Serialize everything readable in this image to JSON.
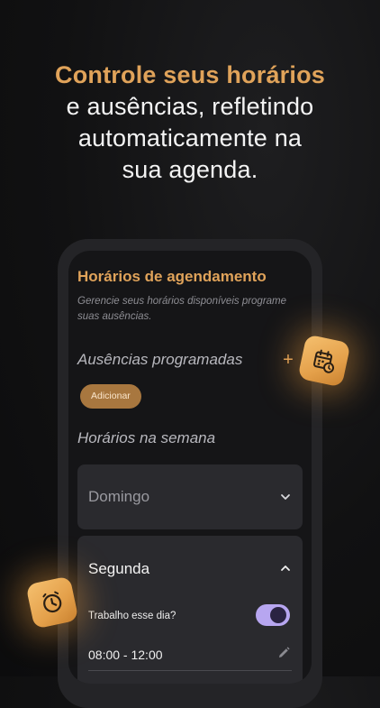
{
  "headline": {
    "line1": "Controle seus horários",
    "line2": "e ausências, refletindo",
    "line3": "automaticamente na",
    "line4": "sua agenda."
  },
  "screen": {
    "title": "Horários de agendamento",
    "subtitle": "Gerencie seus horários disponíveis programe suas ausências.",
    "absences_label": "Ausências programadas",
    "plus_symbol": "+",
    "add_button": "Adicionar",
    "week_label": "Horários na semana",
    "days": [
      {
        "name": "Domingo",
        "expanded": false
      },
      {
        "name": "Segunda",
        "expanded": true,
        "work_question": "Trabalho esse dia?",
        "works": true,
        "time_range": "08:00 - 12:00"
      }
    ]
  },
  "icons": {
    "badge_top": "calendar-clock-icon",
    "badge_bottom": "clock-icon",
    "day_collapsed": "chevron-down-icon",
    "day_expanded": "chevron-up-icon",
    "time_edit": "pencil-icon"
  },
  "colors": {
    "accent": "#e0a35a",
    "button_bg": "#a8773f",
    "toggle_on": "#b7a6f0",
    "background": "#111112",
    "card": "#2a2a2e"
  }
}
